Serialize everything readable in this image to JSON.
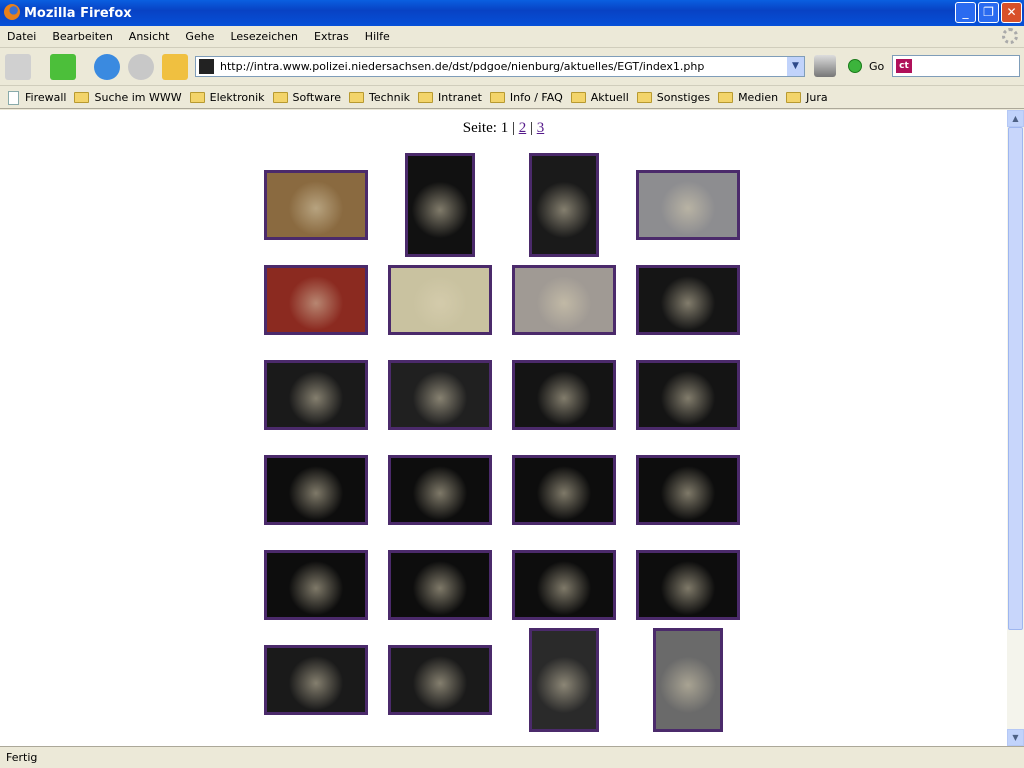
{
  "window": {
    "title": "Mozilla Firefox"
  },
  "menu": [
    "Datei",
    "Bearbeiten",
    "Ansicht",
    "Gehe",
    "Lesezeichen",
    "Extras",
    "Hilfe"
  ],
  "toolbar": {
    "url": "http://intra.www.polizei.niedersachsen.de/dst/pdgoe/nienburg/aktuelles/EGT/index1.php",
    "go_label": "Go",
    "search_engine": "ct"
  },
  "bookmarks": [
    {
      "label": "Firewall",
      "icon": "page-icon"
    },
    {
      "label": "Suche im WWW",
      "icon": "folder-icon"
    },
    {
      "label": "Elektronik",
      "icon": "folder-icon"
    },
    {
      "label": "Software",
      "icon": "folder-icon"
    },
    {
      "label": "Technik",
      "icon": "folder-icon"
    },
    {
      "label": "Intranet",
      "icon": "folder-icon"
    },
    {
      "label": "Info / FAQ",
      "icon": "folder-icon"
    },
    {
      "label": "Aktuell",
      "icon": "folder-icon"
    },
    {
      "label": "Sonstiges",
      "icon": "folder-icon"
    },
    {
      "label": "Medien",
      "icon": "folder-icon"
    },
    {
      "label": "Jura",
      "icon": "folder-icon"
    }
  ],
  "pager": {
    "label": "Seite:",
    "current": "1",
    "sep": "|",
    "links": [
      "2",
      "3"
    ],
    "link_color": "#551a8b"
  },
  "thumb_border_color": "#4b2a6b",
  "thumbnails": [
    [
      {
        "o": "landscape",
        "color": "#8a6a40"
      },
      {
        "o": "portrait",
        "color": "#111111"
      },
      {
        "o": "portrait",
        "color": "#1a1a1a"
      },
      {
        "o": "landscape",
        "color": "#8d8d90"
      }
    ],
    [
      {
        "o": "landscape",
        "color": "#8b2a20"
      },
      {
        "o": "landscape",
        "color": "#c9c2a0"
      },
      {
        "o": "landscape",
        "color": "#a09a94"
      },
      {
        "o": "landscape",
        "color": "#151515"
      }
    ],
    [
      {
        "o": "landscape",
        "color": "#1a1a1a"
      },
      {
        "o": "landscape",
        "color": "#202020"
      },
      {
        "o": "landscape",
        "color": "#141414"
      },
      {
        "o": "landscape",
        "color": "#141414"
      }
    ],
    [
      {
        "o": "landscape",
        "color": "#0d0d0d"
      },
      {
        "o": "landscape",
        "color": "#0d0d0d"
      },
      {
        "o": "landscape",
        "color": "#0d0d0d"
      },
      {
        "o": "landscape",
        "color": "#0d0d0d"
      }
    ],
    [
      {
        "o": "landscape",
        "color": "#0d0d0d"
      },
      {
        "o": "landscape",
        "color": "#0d0d0d"
      },
      {
        "o": "landscape",
        "color": "#0d0d0d"
      },
      {
        "o": "landscape",
        "color": "#0d0d0d"
      }
    ],
    [
      {
        "o": "landscape",
        "color": "#1a1a1a"
      },
      {
        "o": "landscape",
        "color": "#1a1a1a"
      },
      {
        "o": "portrait",
        "color": "#2a2a2a"
      },
      {
        "o": "portrait",
        "color": "#6a6a6a"
      }
    ]
  ],
  "status": {
    "text": "Fertig"
  }
}
